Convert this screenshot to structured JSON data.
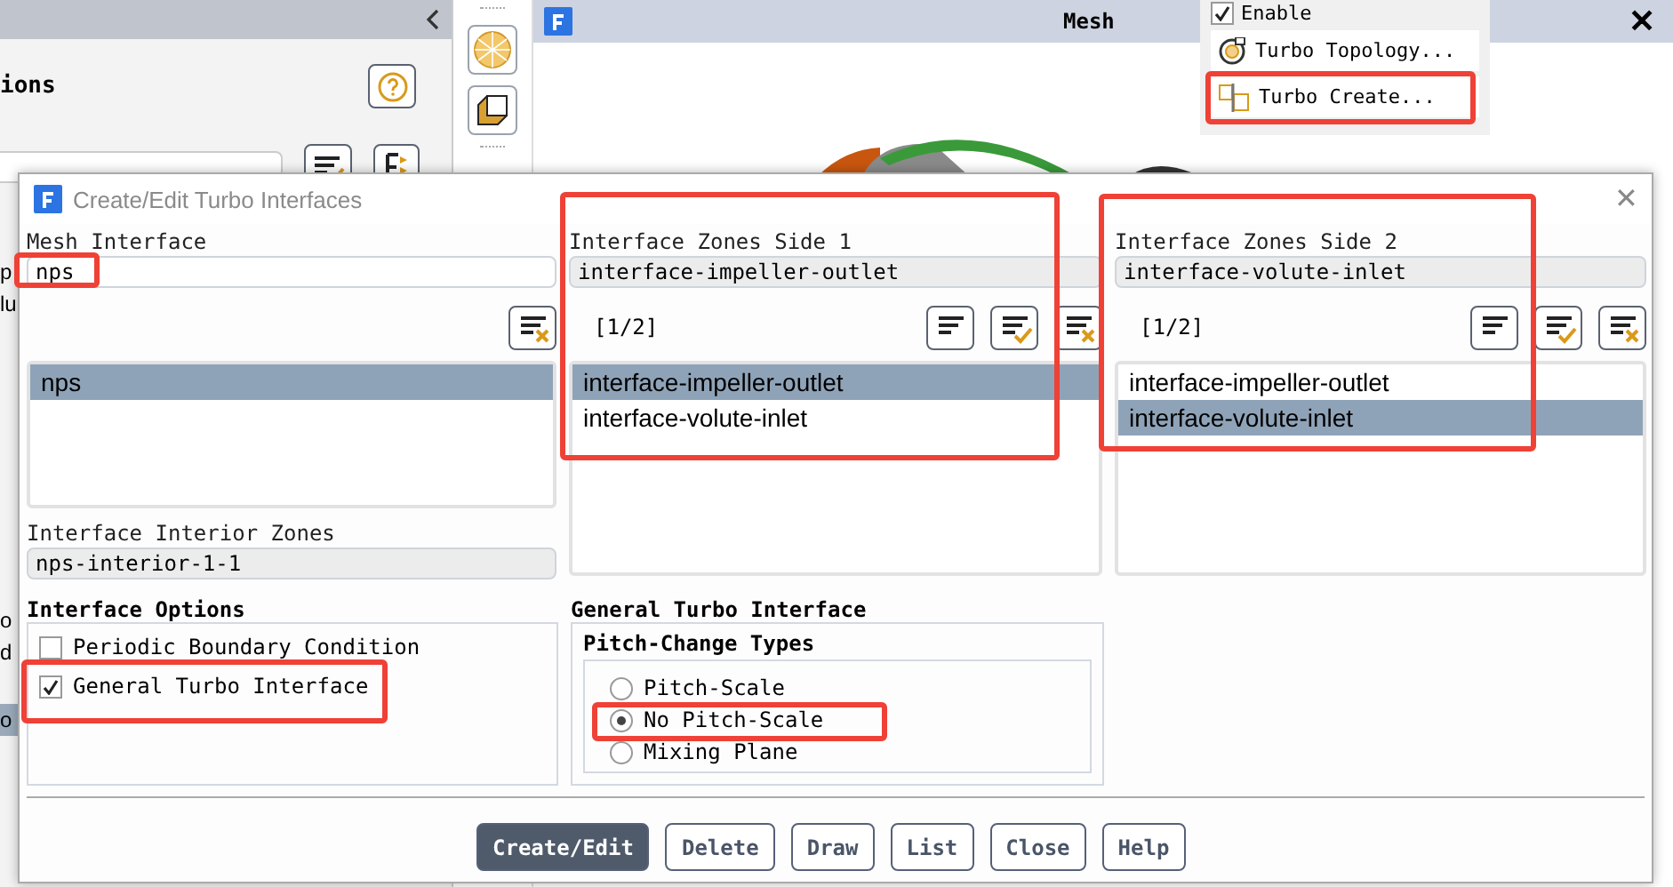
{
  "side_panel": {
    "title": "ions",
    "edge_text": [
      {
        "text": "p",
        "selected": false
      },
      {
        "text": "lu",
        "selected": false
      },
      {
        "text": "o",
        "selected": false
      },
      {
        "text": "d",
        "selected": false
      },
      {
        "text": "o",
        "selected": true
      }
    ]
  },
  "graphics_window": {
    "title": "Mesh",
    "close": "✕"
  },
  "turbo_menu": {
    "enable": {
      "label": "Enable",
      "checked": true
    },
    "items": [
      {
        "label": "Turbo Topology...",
        "kind": "topology",
        "highlighted": false
      },
      {
        "label": "Turbo Create...",
        "kind": "create",
        "highlighted": true
      }
    ]
  },
  "dialog": {
    "title": "Create/Edit Turbo Interfaces",
    "close": "✕",
    "mesh_interface": {
      "label": "Mesh Interface",
      "value": "nps",
      "highlighted": true,
      "items": [
        {
          "label": "nps",
          "selected": true
        }
      ]
    },
    "interior_zones": {
      "label": "Interface Interior Zones",
      "value": "nps-interior-1-1"
    },
    "sides": [
      {
        "label": "Interface Zones Side 1",
        "value": "interface-impeller-outlet",
        "count": "[1/2]",
        "highlighted": true,
        "items": [
          {
            "label": "interface-impeller-outlet",
            "selected": true
          },
          {
            "label": "interface-volute-inlet",
            "selected": false
          }
        ]
      },
      {
        "label": "Interface Zones Side 2",
        "value": "interface-volute-inlet",
        "count": "[1/2]",
        "highlighted": true,
        "items": [
          {
            "label": "interface-impeller-outlet",
            "selected": false
          },
          {
            "label": "interface-volute-inlet",
            "selected": true
          }
        ]
      }
    ],
    "interface_options": {
      "title": "Interface Options",
      "options": [
        {
          "label": "Periodic Boundary Condition",
          "checked": false,
          "highlighted": false
        },
        {
          "label": "General Turbo Interface",
          "checked": true,
          "highlighted": true
        }
      ]
    },
    "general_turbo": {
      "title": "General Turbo Interface",
      "group": "Pitch-Change Types",
      "types": [
        {
          "label": "Pitch-Scale",
          "selected": false,
          "highlighted": false
        },
        {
          "label": "No Pitch-Scale",
          "selected": true,
          "highlighted": true
        },
        {
          "label": "Mixing Plane",
          "selected": false,
          "highlighted": false
        }
      ]
    },
    "buttons": [
      {
        "label": "Create/Edit",
        "primary": true
      },
      {
        "label": "Delete",
        "primary": false
      },
      {
        "label": "Draw",
        "primary": false
      },
      {
        "label": "List",
        "primary": false
      },
      {
        "label": "Close",
        "primary": false
      },
      {
        "label": "Help",
        "primary": false
      }
    ]
  }
}
